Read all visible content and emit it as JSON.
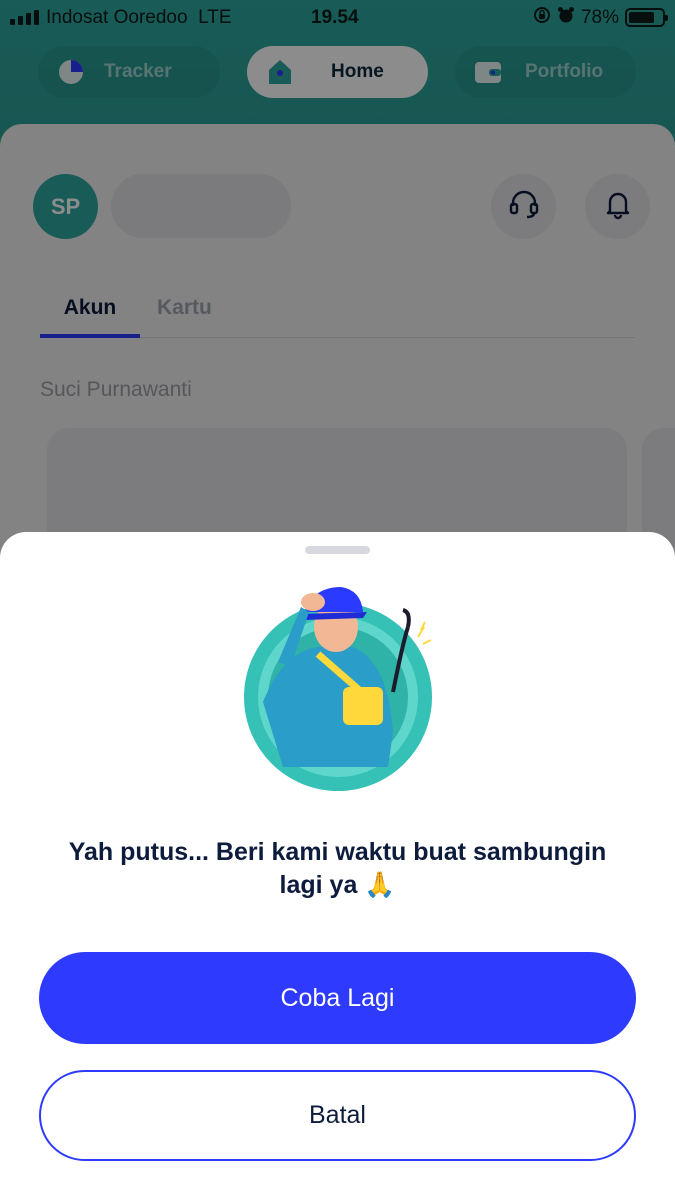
{
  "status_bar": {
    "carrier": "Indosat Ooredoo",
    "network": "LTE",
    "time": "19.54",
    "battery_percent": "78%",
    "battery_level": 0.78
  },
  "nav": {
    "tabs": [
      {
        "label": "Tracker",
        "icon": "pie-chart-icon"
      },
      {
        "label": "Home",
        "icon": "home-icon"
      },
      {
        "label": "Portfolio",
        "icon": "wallet-icon"
      }
    ],
    "active": "Home"
  },
  "profile": {
    "initials": "SP"
  },
  "account_tabs": {
    "akun": "Akun",
    "kartu": "Kartu"
  },
  "account_name": "Suci Purnawanti",
  "dialog": {
    "message": "Yah putus... Beri kami waktu buat sambungin lagi ya 🙏",
    "retry_label": "Coba Lagi",
    "cancel_label": "Batal"
  },
  "colors": {
    "teal": "#2ea79e",
    "primary_blue": "#2e3bff",
    "text_dark": "#0d1b3c"
  }
}
